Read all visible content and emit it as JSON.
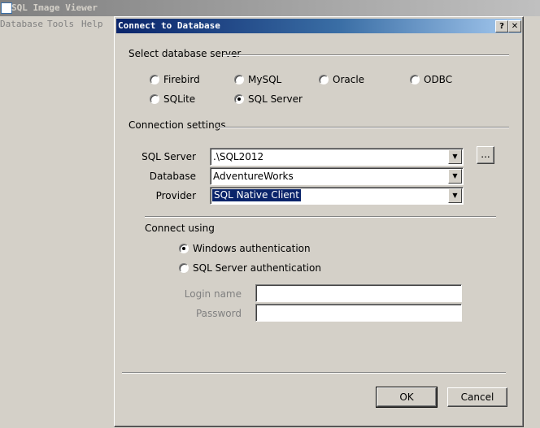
{
  "app": {
    "title": "SQL Image Viewer",
    "menu": [
      "Database",
      "Tools",
      "Help"
    ]
  },
  "dialog": {
    "title": "Connect to Database",
    "help_btn": "?",
    "close_btn": "✕",
    "server_group": {
      "label": "Select database server",
      "options": [
        {
          "label": "Firebird",
          "checked": false
        },
        {
          "label": "MySQL",
          "checked": false
        },
        {
          "label": "Oracle",
          "checked": false
        },
        {
          "label": "ODBC",
          "checked": false
        },
        {
          "label": "SQLite",
          "checked": false
        },
        {
          "label": "SQL Server",
          "checked": true
        }
      ]
    },
    "connection_group": {
      "label": "Connection settings",
      "sql_server_label": "SQL Server",
      "sql_server_value": ".\\SQL2012",
      "browse_label": "...",
      "database_label": "Database",
      "database_value": "AdventureWorks",
      "provider_label": "Provider",
      "provider_value": "SQL Native Client"
    },
    "connect_using": {
      "label": "Connect using",
      "windows_auth": "Windows authentication",
      "sql_auth": "SQL Server authentication",
      "login_label": "Login name",
      "password_label": "Password",
      "login_value": "",
      "password_value": ""
    },
    "ok_label": "OK",
    "cancel_label": "Cancel"
  }
}
